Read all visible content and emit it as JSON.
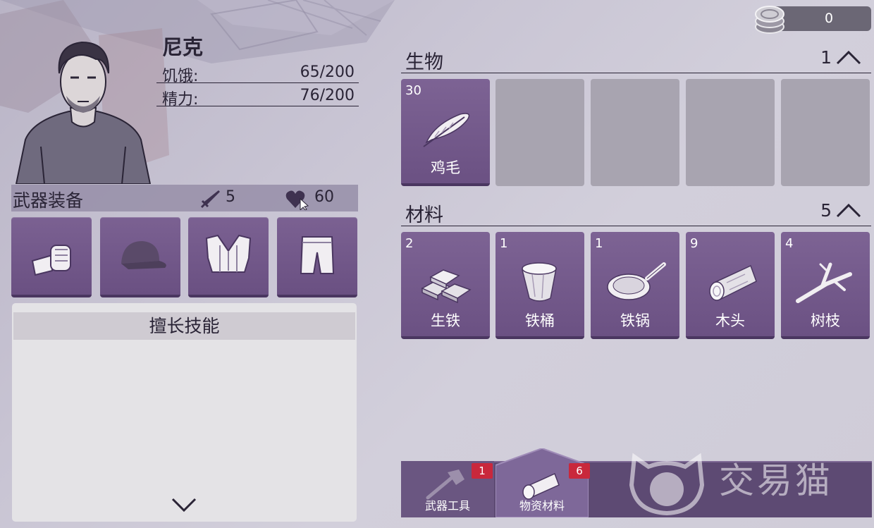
{
  "currency": {
    "icon": "coin-stack-icon",
    "amount": "0"
  },
  "character": {
    "name": "尼克",
    "stats": [
      {
        "label": "饥饿:",
        "value": "65/200"
      },
      {
        "label": "精力:",
        "value": "76/200"
      }
    ]
  },
  "equipment": {
    "title": "武器装备",
    "attack": {
      "icon": "sword-icon",
      "value": "5"
    },
    "health": {
      "icon": "heart-icon",
      "value": "60"
    },
    "slots": [
      {
        "icon": "fist-icon"
      },
      {
        "icon": "cap-icon"
      },
      {
        "icon": "vest-icon"
      },
      {
        "icon": "shorts-icon"
      }
    ]
  },
  "skills": {
    "title": "擅长技能",
    "toggle_icon": "chevron-down-icon"
  },
  "categories": [
    {
      "title": "生物",
      "count": "1",
      "toggle_icon": "chevron-up-icon",
      "items": [
        {
          "qty": "30",
          "name": "鸡毛",
          "icon": "feather-icon"
        }
      ],
      "empty_slots": 4
    },
    {
      "title": "材料",
      "count": "5",
      "toggle_icon": "chevron-up-icon",
      "items": [
        {
          "qty": "2",
          "name": "生铁",
          "icon": "iron-ingot-icon"
        },
        {
          "qty": "1",
          "name": "铁桶",
          "icon": "bucket-icon"
        },
        {
          "qty": "1",
          "name": "铁锅",
          "icon": "pan-icon"
        },
        {
          "qty": "9",
          "name": "木头",
          "icon": "log-icon"
        },
        {
          "qty": "4",
          "name": "树枝",
          "icon": "branch-icon"
        }
      ]
    }
  ],
  "tabs": [
    {
      "label": "武器工具",
      "badge": "1",
      "icon": "axe-icon",
      "active": false
    },
    {
      "label": "物资材料",
      "badge": "6",
      "icon": "log-icon",
      "active": true
    }
  ],
  "watermark": {
    "text": "交易猫",
    "icon": "cat-logo-icon"
  },
  "colors": {
    "accent_purple": "#6b5183",
    "badge_red": "#c9283c",
    "coin_bar": "#6b6775"
  }
}
